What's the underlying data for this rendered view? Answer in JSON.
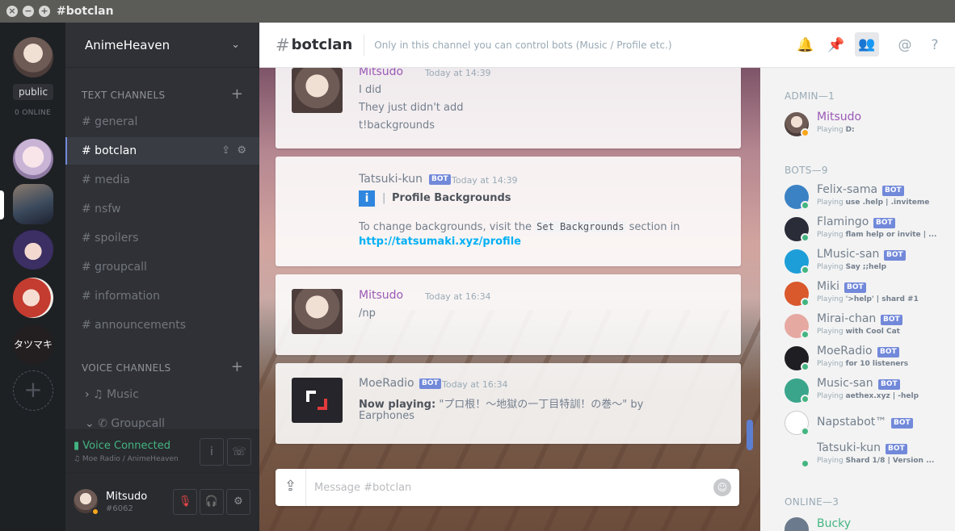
{
  "window": {
    "title": "#botclan"
  },
  "guilds": {
    "public_tag": "public",
    "online_count": "0 ONLINE",
    "tatsumaki_label": "タツマキ"
  },
  "server": {
    "name": "AnimeHeaven"
  },
  "text_channels": {
    "label": "TEXT CHANNELS",
    "items": [
      "# general",
      "# botclan",
      "# media",
      "# nsfw",
      "# spoilers",
      "# groupcall",
      "# information",
      "# announcements"
    ]
  },
  "voice_channels": {
    "label": "VOICE CHANNELS",
    "items": [
      "♫ Music",
      "✆ Groupcall"
    ]
  },
  "voice_status": {
    "title": "Voice Connected",
    "sub": "♫ Moe Radio / AnimeHeaven"
  },
  "user": {
    "name": "Mitsudo",
    "discriminator": "#6062"
  },
  "channel_header": {
    "hash": "#",
    "name": "botclan",
    "topic": "Only in this channel you can control bots (Music / Profile etc.)"
  },
  "messages": [
    {
      "author": "Mitsudo",
      "time": "Today at 14:39",
      "lines": [
        "I did",
        "They just didn't add",
        "t!backgrounds"
      ]
    },
    {
      "author": "Tatsuki-kun",
      "bot": "BOT",
      "time": "Today at 14:39",
      "embed_title": "Profile Backgrounds",
      "text_before": "To change backgrounds, visit the",
      "code": "Set Backgrounds",
      "text_after": "section in",
      "link": "http://tatsumaki.xyz/profile"
    },
    {
      "author": "Mitsudo",
      "time": "Today at 16:34",
      "lines": [
        "/np"
      ]
    },
    {
      "author": "MoeRadio",
      "bot": "BOT",
      "time": "Today at 16:34",
      "label": "Now playing:",
      "song": "\"プロ根！〜地獄の一丁目特訓！の巻〜\" by",
      "artist": "Earphones"
    }
  ],
  "composer": {
    "placeholder": "Message #botclan"
  },
  "member_list": {
    "admin_label": "ADMIN—1",
    "bots_label": "BOTS—9",
    "online_label": "ONLINE—3",
    "admin": [
      {
        "name": "Mitsudo",
        "playing": "Playing",
        "game": "D:",
        "color": "#9b59b6",
        "status": "#faa61a"
      }
    ],
    "bots": [
      {
        "name": "Felix-sama",
        "playing": "Playing",
        "game": "use .help | .inviteme",
        "avatar": "#3b82c4"
      },
      {
        "name": "Flamingo",
        "playing": "Playing",
        "game": "flam help or invite | ...",
        "avatar": "#2a2d38"
      },
      {
        "name": "LMusic-san",
        "playing": "Playing",
        "game": "Say ;;help",
        "avatar": "#1d9ed8"
      },
      {
        "name": "Miki",
        "playing": "Playing",
        "game": "'>help' | shard #1",
        "avatar": "#d9582c"
      },
      {
        "name": "Mirai-chan",
        "playing": "Playing",
        "game": "with Cool Cat",
        "avatar": "#e6a9a2"
      },
      {
        "name": "MoeRadio",
        "playing": "Playing",
        "game": "for 10 listeners",
        "avatar": "#1f1f23"
      },
      {
        "name": "Music-san",
        "playing": "Playing",
        "game": "aethex.xyz | -help",
        "avatar": "#3aa58b"
      },
      {
        "name": "Napstabot™",
        "playing": "",
        "game": "",
        "avatar": "#ffffff"
      },
      {
        "name": "Tatsuki-kun",
        "playing": "Playing",
        "game": "Shard 1/8 | Version ...",
        "avatar": "#f3f3f3"
      }
    ],
    "online": [
      {
        "name": "Bucky"
      }
    ],
    "bot_tag": "BOT",
    "online_status": "#43b581"
  }
}
